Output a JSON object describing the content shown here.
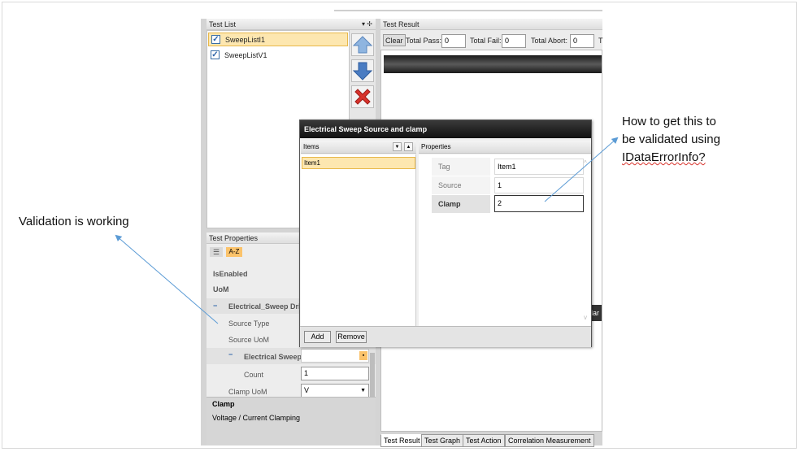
{
  "test_list": {
    "header": "Test List",
    "header_icons": "▾ ✢",
    "items": [
      {
        "label": "SweepListI1",
        "checked": true,
        "selected": true
      },
      {
        "label": "SweepListV1",
        "checked": true,
        "selected": false
      }
    ]
  },
  "test_result": {
    "header": "Test Result",
    "clear_label": "Clear",
    "total_pass_label": "Total Pass:",
    "total_pass_value": "0",
    "total_fail_label": "Total Fail:",
    "total_fail_value": "0",
    "total_abort_label": "Total Abort:",
    "total_abort_value": "0",
    "cut_label": "T",
    "partial_tab_text": "dar"
  },
  "test_properties": {
    "header": "Test Properties",
    "sort_label": "A-Z",
    "rows": [
      {
        "name": "IsEnabled"
      },
      {
        "name": "UoM"
      },
      {
        "name": "Electrical_Sweep Drive",
        "group": true
      },
      {
        "name": "Source Type"
      },
      {
        "name": "Source UoM"
      },
      {
        "name": "Electrical Sweep",
        "group": true
      },
      {
        "name": "Count",
        "value": "1"
      },
      {
        "name": "Clamp UoM",
        "value": "V"
      }
    ],
    "desc_title": "Clamp",
    "desc_text": "Voltage / Current Clamping"
  },
  "bottom_tabs": [
    "Test Result",
    "Test Graph",
    "Test Action",
    "Correlation Measurement"
  ],
  "dialog": {
    "title": "Electrical Sweep Source and clamp",
    "items_header": "Items",
    "properties_header": "Properties",
    "items": [
      "Item1"
    ],
    "props": [
      {
        "name": "Tag",
        "value": "Item1"
      },
      {
        "name": "Source",
        "value": "1"
      },
      {
        "name": "Clamp",
        "value": "2"
      }
    ],
    "add_label": "Add",
    "remove_label": "Remove"
  },
  "annotations": {
    "left": "Validation is working",
    "right_1": "How to get this to",
    "right_2": "be validated using",
    "right_3": "IDataErrorInfo?"
  },
  "colors": {
    "selected_bg": "#fde7b0",
    "selected_border": "#e8b84a",
    "arrow_blue": "#5b9bd5",
    "error_red": "#d8322b"
  }
}
